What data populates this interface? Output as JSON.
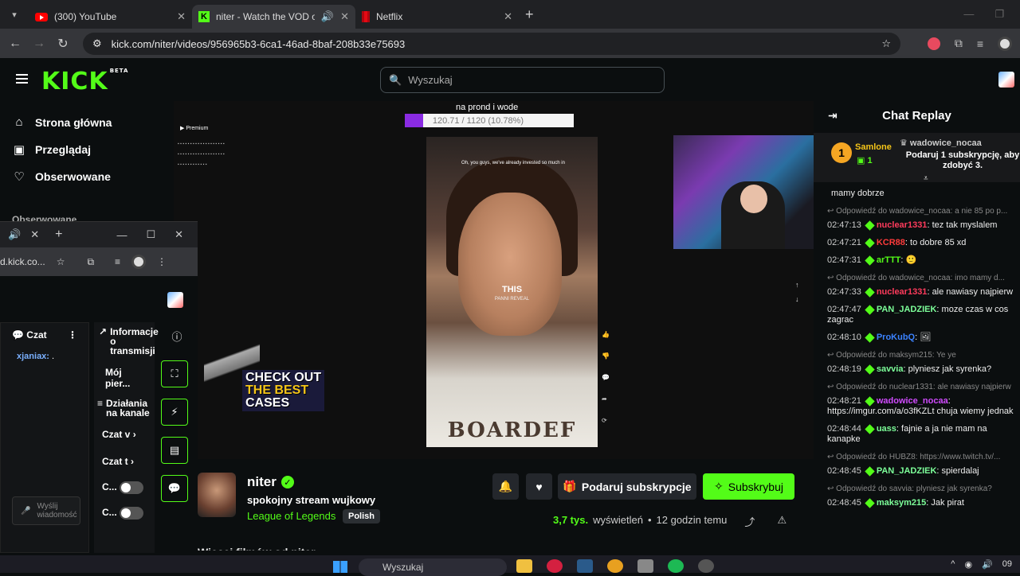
{
  "browser": {
    "tabs": [
      {
        "title": "(300) YouTube",
        "favicon": "youtube-icon"
      },
      {
        "title": "niter - Watch the VOD on K",
        "favicon": "kick-icon",
        "active": true
      },
      {
        "title": "Netflix",
        "favicon": "netflix-icon"
      }
    ],
    "url": "kick.com/niter/videos/956965b3-6ca1-46ad-8baf-208b33e75693"
  },
  "kick": {
    "logo": "KICK",
    "beta": "BETA",
    "search_placeholder": "Wyszukaj",
    "accent": "#53fc18"
  },
  "sidebar": {
    "items": [
      {
        "label": "Strona główna",
        "icon": "home-icon"
      },
      {
        "label": "Przeglądaj",
        "icon": "browse-icon"
      },
      {
        "label": "Obserwowane",
        "icon": "heart-icon"
      }
    ],
    "section": "Obserwowane"
  },
  "popout": {
    "addr": "d.kick.co...",
    "chat_label": "Czat",
    "chat_user": "xjaniax:",
    "chat_text": ".",
    "info_title": "Informacje o transmisji",
    "my_label": "Mój pier...",
    "actions_title": "Działania na kanale",
    "row1": "Czat v",
    "row2": "Czat t",
    "row3": "C...",
    "row4": "C...",
    "send_placeholder": "Wyślij wiadomość"
  },
  "video": {
    "overlay_title": "na prond i wode",
    "overlay_progress": "120.71 / 1120 (10.78%)",
    "overlay_progress_pct": 10.78,
    "caption": "Oh, you guys, we've already invested so much in",
    "center_big": "THIS",
    "center_small": "PANNI REVEAL",
    "ad_line1": "CHECK OUT",
    "ad_line2": "THE BEST",
    "ad_line3": "CASES",
    "shirt": "BOARDEF",
    "yt_brand": "Premium"
  },
  "channel": {
    "name": "niter",
    "title": "spokojny stream wujkowy",
    "category": "League of Legends",
    "language": "Polish",
    "gift_label": "Podaruj subskrypcje",
    "subscribe_label": "Subskrybuj",
    "views_num": "3,7 tys.",
    "views_label": "wyświetleń",
    "dot": "•",
    "ago": "12 godzin temu",
    "more_title": "Więcej filmów od niter"
  },
  "chat": {
    "header": "Chat Replay",
    "pinned": {
      "rank": "1",
      "user1": "Samlone",
      "count": "1",
      "user2": "wadowice_nocaa",
      "text": "Podaruj 1 subskrypcję, aby zdobyć 3."
    },
    "messages": [
      {
        "reply": "",
        "time": "",
        "user": "",
        "color": "#eee",
        "text": "mamy dobrze"
      },
      {
        "reply": "Odpowiedź do wadowice_nocaa: a nie 85 po p...",
        "time": "02:47:13",
        "user": "nuclear1331",
        "color": "#ff3b5c",
        "text": "tez tak myslalem"
      },
      {
        "reply": "",
        "time": "02:47:21",
        "user": "KCR88",
        "color": "#ff3b3b",
        "text": "to dobre 85 xd"
      },
      {
        "reply": "",
        "time": "02:47:31",
        "user": "arTTT",
        "color": "#53fc18",
        "text": "🙂"
      },
      {
        "reply": "Odpowiedź do wadowice_nocaa: imo mamy d...",
        "time": "02:47:33",
        "user": "nuclear1331",
        "color": "#ff3b5c",
        "text": "ale nawiasy najpierw"
      },
      {
        "reply": "",
        "time": "02:47:47",
        "user": "PAN_JADZIEK",
        "color": "#7dff9a",
        "text": "moze czas w cos zagrac"
      },
      {
        "reply": "",
        "time": "02:48:10",
        "user": "ProKubQ",
        "color": "#3b82ff",
        "text": "🖼"
      },
      {
        "reply": "Odpowiedź do maksym215: Ye ye",
        "time": "02:48:19",
        "user": "savvia",
        "color": "#7dff9a",
        "text": "plyniesz jak syrenka?"
      },
      {
        "reply": "Odpowiedź do nuclear1331: ale nawiasy najpierw",
        "time": "02:48:21",
        "user": "wadowice_nocaa",
        "color": "#d14bff",
        "text": "https://imgur.com/a/o3fKZLt chuja wiemy jednak"
      },
      {
        "reply": "",
        "time": "02:48:44",
        "user": "uass",
        "color": "#7dff9a",
        "text": "fajnie a ja nie mam na kanapke"
      },
      {
        "reply": "Odpowiedź do HUBZ8: https://www.twitch.tv/...",
        "time": "02:48:45",
        "user": "PAN_JADZIEK",
        "color": "#7dff9a",
        "text": "spierdalaj"
      },
      {
        "reply": "Odpowiedź do savvia: plyniesz jak syrenka?",
        "time": "02:48:45",
        "user": "maksym215",
        "color": "#7dff9a",
        "text": "Jak pirat"
      }
    ]
  },
  "taskbar": {
    "search": "Wyszukaj",
    "clock": "09"
  }
}
